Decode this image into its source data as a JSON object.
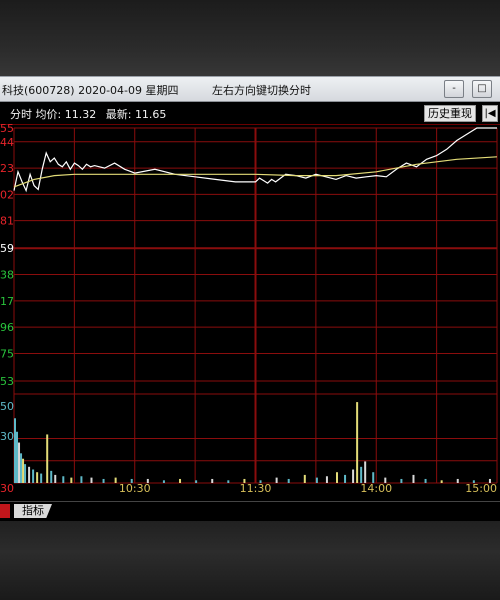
{
  "window": {
    "title": "科技(600728) 2020-04-09 星期四",
    "hint": "左右方向键切换分时",
    "buttons": [
      "-",
      "□"
    ]
  },
  "toolbar": {
    "mode_label": "分时",
    "avg_label": "均价:",
    "avg_value": "11.32",
    "last_label": "最新:",
    "last_value": "11.65",
    "replay_label": "历史重现",
    "replay_icon": "back-to-start-icon"
  },
  "bottom_tabs": [
    "",
    "指标"
  ],
  "colors": {
    "grid": "#8a0d0d",
    "up": "#e8242a",
    "down": "#29c43c",
    "price_line": "#ffffff",
    "avg_line": "#e3dc78",
    "time_labels": "#d8c05a"
  },
  "chart_data": {
    "type": "line",
    "title": "",
    "xlabel": "",
    "ylabel": "",
    "reference_price": "10.59",
    "price_ylim": [
      9.63,
      11.55
    ],
    "y_tick_labels": [
      {
        "text": "55",
        "value": 11.55,
        "side": "up"
      },
      {
        "text": "44",
        "value": 11.44,
        "side": "up"
      },
      {
        "text": "23",
        "value": 11.23,
        "side": "up"
      },
      {
        "text": "02",
        "value": 11.02,
        "side": "up"
      },
      {
        "text": "81",
        "value": 10.81,
        "side": "up"
      },
      {
        "text": "59",
        "value": 10.59,
        "side": "ref"
      },
      {
        "text": "38",
        "value": 10.38,
        "side": "down"
      },
      {
        "text": "17",
        "value": 10.17,
        "side": "down"
      },
      {
        "text": "96",
        "value": 9.96,
        "side": "down"
      },
      {
        "text": "75",
        "value": 9.75,
        "side": "down"
      },
      {
        "text": "53",
        "value": 9.53,
        "side": "down"
      }
    ],
    "volume_tick_labels": [
      "50",
      "30"
    ],
    "x_tick_labels": [
      "30",
      "10:30",
      "11:30",
      "14:00",
      "15:00"
    ],
    "series": [
      {
        "kind": "price",
        "x": [
          0,
          2,
          4,
          6,
          8,
          10,
          12,
          14,
          16,
          18,
          20,
          22,
          24,
          26,
          28,
          30,
          32,
          34,
          36,
          38,
          40,
          45,
          50,
          55,
          60,
          70,
          80,
          90,
          100,
          110,
          120,
          122,
          124,
          126,
          128,
          130,
          135,
          140,
          145,
          150,
          155,
          160,
          165,
          170,
          175,
          180,
          185,
          190,
          195,
          200,
          205,
          210,
          215,
          220,
          225,
          230,
          235,
          240
        ],
        "values": [
          11.05,
          11.2,
          11.12,
          11.05,
          11.18,
          11.09,
          11.06,
          11.22,
          11.35,
          11.28,
          11.31,
          11.26,
          11.24,
          11.28,
          11.22,
          11.27,
          11.25,
          11.22,
          11.26,
          11.24,
          11.25,
          11.23,
          11.27,
          11.22,
          11.19,
          11.22,
          11.18,
          11.16,
          11.14,
          11.12,
          11.12,
          11.15,
          11.13,
          11.11,
          11.14,
          11.12,
          11.18,
          11.17,
          11.15,
          11.18,
          11.16,
          11.14,
          11.17,
          11.15,
          11.16,
          11.17,
          11.16,
          11.22,
          11.27,
          11.24,
          11.3,
          11.33,
          11.38,
          11.45,
          11.5,
          11.55,
          11.55,
          11.55
        ]
      },
      {
        "kind": "average",
        "x": [
          0,
          10,
          20,
          30,
          40,
          60,
          80,
          100,
          120,
          140,
          160,
          180,
          200,
          220,
          240
        ],
        "values": [
          11.08,
          11.14,
          11.17,
          11.18,
          11.18,
          11.18,
          11.18,
          11.18,
          11.18,
          11.17,
          11.17,
          11.2,
          11.26,
          11.3,
          11.32
        ]
      }
    ],
    "volume_bars": [
      {
        "x": 0,
        "v": 48,
        "c": "#5fb9c8"
      },
      {
        "x": 1,
        "v": 38,
        "c": "#5fb9c8"
      },
      {
        "x": 2,
        "v": 30,
        "c": "#d9d9d9"
      },
      {
        "x": 3,
        "v": 22,
        "c": "#5fb9c8"
      },
      {
        "x": 4,
        "v": 18,
        "c": "#e3dc78"
      },
      {
        "x": 5,
        "v": 14,
        "c": "#5fb9c8"
      },
      {
        "x": 7,
        "v": 12,
        "c": "#d9d9d9"
      },
      {
        "x": 9,
        "v": 10,
        "c": "#5fb9c8"
      },
      {
        "x": 11,
        "v": 8,
        "c": "#e3dc78"
      },
      {
        "x": 13,
        "v": 7,
        "c": "#5fb9c8"
      },
      {
        "x": 16,
        "v": 36,
        "c": "#e3dc78"
      },
      {
        "x": 18,
        "v": 9,
        "c": "#5fb9c8"
      },
      {
        "x": 20,
        "v": 6,
        "c": "#d9d9d9"
      },
      {
        "x": 24,
        "v": 5,
        "c": "#5fb9c8"
      },
      {
        "x": 28,
        "v": 4,
        "c": "#e3dc78"
      },
      {
        "x": 33,
        "v": 5,
        "c": "#5fb9c8"
      },
      {
        "x": 38,
        "v": 4,
        "c": "#d9d9d9"
      },
      {
        "x": 44,
        "v": 3,
        "c": "#5fb9c8"
      },
      {
        "x": 50,
        "v": 4,
        "c": "#e3dc78"
      },
      {
        "x": 58,
        "v": 3,
        "c": "#5fb9c8"
      },
      {
        "x": 66,
        "v": 3,
        "c": "#d9d9d9"
      },
      {
        "x": 74,
        "v": 2,
        "c": "#5fb9c8"
      },
      {
        "x": 82,
        "v": 3,
        "c": "#e3dc78"
      },
      {
        "x": 90,
        "v": 2,
        "c": "#5fb9c8"
      },
      {
        "x": 98,
        "v": 3,
        "c": "#d9d9d9"
      },
      {
        "x": 106,
        "v": 2,
        "c": "#5fb9c8"
      },
      {
        "x": 114,
        "v": 3,
        "c": "#e3dc78"
      },
      {
        "x": 122,
        "v": 2,
        "c": "#5fb9c8"
      },
      {
        "x": 130,
        "v": 4,
        "c": "#d9d9d9"
      },
      {
        "x": 136,
        "v": 3,
        "c": "#5fb9c8"
      },
      {
        "x": 144,
        "v": 6,
        "c": "#e3dc78"
      },
      {
        "x": 150,
        "v": 4,
        "c": "#5fb9c8"
      },
      {
        "x": 155,
        "v": 5,
        "c": "#d9d9d9"
      },
      {
        "x": 160,
        "v": 8,
        "c": "#e3dc78"
      },
      {
        "x": 164,
        "v": 6,
        "c": "#5fb9c8"
      },
      {
        "x": 168,
        "v": 10,
        "c": "#d9d9d9"
      },
      {
        "x": 170,
        "v": 60,
        "c": "#e3dc78"
      },
      {
        "x": 172,
        "v": 12,
        "c": "#5fb9c8"
      },
      {
        "x": 174,
        "v": 16,
        "c": "#d9d9d9"
      },
      {
        "x": 178,
        "v": 8,
        "c": "#5fb9c8"
      },
      {
        "x": 184,
        "v": 4,
        "c": "#d9d9d9"
      },
      {
        "x": 192,
        "v": 3,
        "c": "#5fb9c8"
      },
      {
        "x": 198,
        "v": 6,
        "c": "#d9d9d9"
      },
      {
        "x": 204,
        "v": 3,
        "c": "#5fb9c8"
      },
      {
        "x": 212,
        "v": 2,
        "c": "#e3dc78"
      },
      {
        "x": 220,
        "v": 3,
        "c": "#d9d9d9"
      },
      {
        "x": 228,
        "v": 2,
        "c": "#5fb9c8"
      },
      {
        "x": 236,
        "v": 3,
        "c": "#d9d9d9"
      }
    ]
  }
}
